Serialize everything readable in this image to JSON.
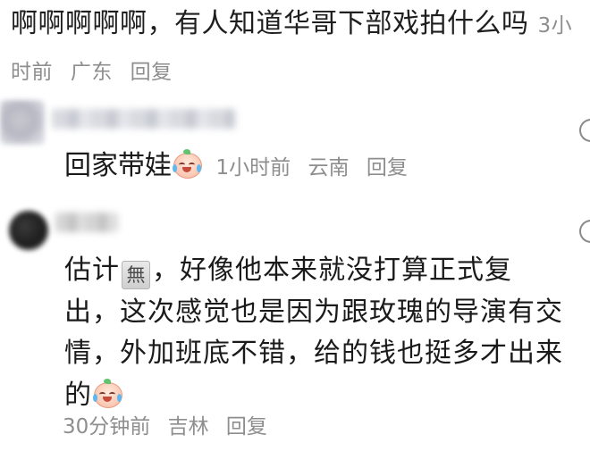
{
  "top_comment": {
    "text": "啊啊啊啊啊，有人知道华哥下部戏拍什么吗",
    "time": "3小时前",
    "location": "广东",
    "reply_label": "回复"
  },
  "reply1": {
    "text": "回家带娃",
    "emoji": "crying-face-emoji",
    "time": "1小时前",
    "location": "云南",
    "reply_label": "回复"
  },
  "reply2": {
    "text_a": "估计",
    "wu_icon_char": "無",
    "text_b": "，好像他本来就没打算正式复出，这次感觉也是因为跟玫瑰的导演有交情，外加班底不错，给的钱也挺多才出来的",
    "emoji": "crying-face-emoji",
    "time": "30分钟前",
    "location": "吉林",
    "reply_label": "回复"
  }
}
